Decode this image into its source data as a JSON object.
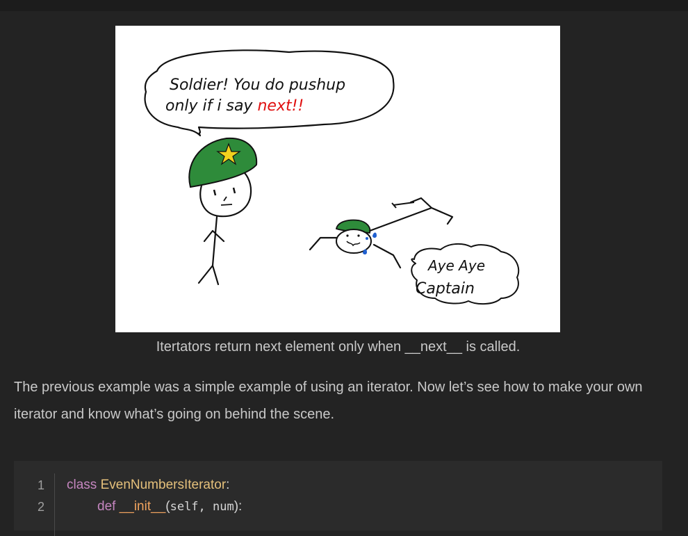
{
  "figure": {
    "speech_line1": "Soldier! You do pushup",
    "speech_line2a": "only if i say ",
    "speech_line2b": "next",
    "speech_line2c": "!!",
    "reply_line1": "Aye Aye",
    "reply_line2": "Captain"
  },
  "caption": "Itertators return next element only when __next__ is called.",
  "paragraph": "The previous example was a simple example of using an iterator. Now let’s see how to make your own iterator and know what’s going on behind the scene.",
  "code": {
    "line_numbers": [
      "1",
      "2"
    ],
    "line1": {
      "kw": "class",
      "name": "EvenNumbersIterator",
      "punct": ":"
    },
    "line2": {
      "kw": "def",
      "name": "__init__",
      "open": "(",
      "args": "self, num",
      "close": "):"
    }
  },
  "colors": {
    "background": "#232323",
    "code_background": "#2b2b2b",
    "keyword": "#c586c0",
    "class_name": "#e5c07b",
    "function_name": "#f0a35e",
    "highlight_red": "#e01010",
    "helmet_green": "#2e8b3a"
  }
}
